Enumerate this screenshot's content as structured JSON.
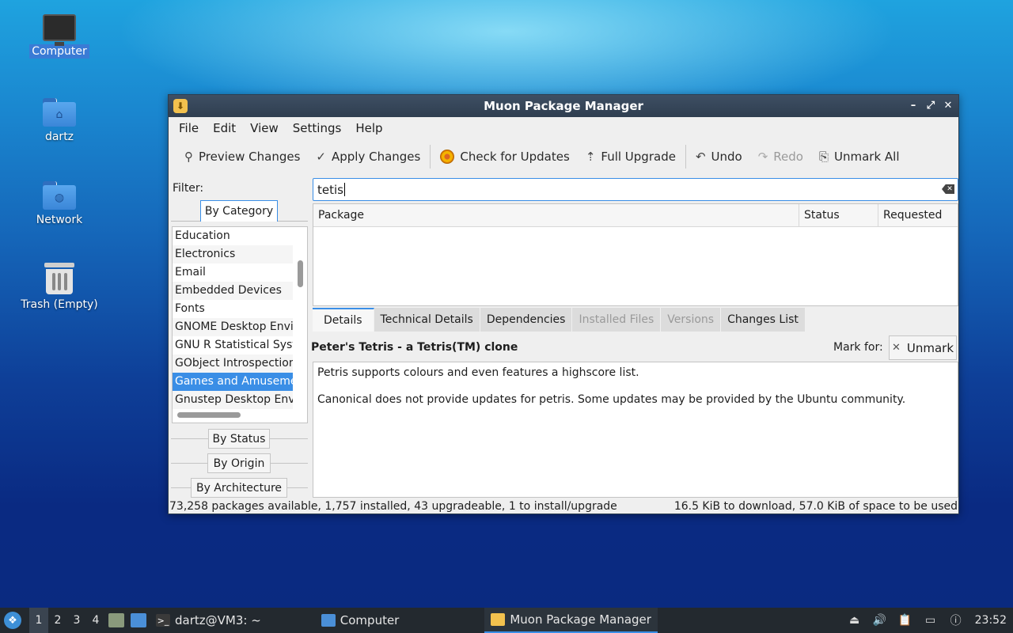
{
  "desktop": {
    "icons": [
      {
        "label": "Computer"
      },
      {
        "label": "dartz"
      },
      {
        "label": "Network"
      },
      {
        "label": "Trash (Empty)"
      }
    ]
  },
  "window": {
    "title": "Muon Package Manager",
    "menu": [
      "File",
      "Edit",
      "View",
      "Settings",
      "Help"
    ],
    "toolbar": {
      "preview": "Preview Changes",
      "apply": "Apply Changes",
      "check": "Check for Updates",
      "upgrade": "Full Upgrade",
      "undo": "Undo",
      "redo": "Redo",
      "unmark_all": "Unmark All"
    },
    "filter": {
      "label": "Filter:",
      "by_category": "By Category",
      "categories": [
        "Education",
        "Electronics",
        "Email",
        "Embedded Devices",
        "Fonts",
        "GNOME Desktop Envi",
        "GNU R Statistical Syst",
        "GObject Introspection",
        "Games and Amuseme",
        "Gnustep Desktop Envi"
      ],
      "selected_category": "Games and Amuseme",
      "by_status": "By Status",
      "by_origin": "By Origin",
      "by_architecture": "By Architecture"
    },
    "search": {
      "value": "tetis"
    },
    "table": {
      "columns": [
        "Package",
        "Status",
        "Requested"
      ]
    },
    "tabs": {
      "details": "Details",
      "technical": "Technical Details",
      "dependencies": "Dependencies",
      "installed_files": "Installed Files",
      "versions": "Versions",
      "changes": "Changes List"
    },
    "details": {
      "title": "Peter's Tetris - a Tetris(TM) clone",
      "mark_for": "Mark for:",
      "unmark": "Unmark",
      "desc1": "Petris supports colours and even features a highscore list.",
      "desc2": "Canonical does not provide updates for petris. Some updates may be provided by the Ubuntu community."
    },
    "status": {
      "left": "73,258 packages available, 1,757 installed, 43 upgradeable, 1 to install/upgrade",
      "right": "16.5 KiB to download, 57.0 KiB of space to be used"
    }
  },
  "taskbar": {
    "workspaces": [
      "1",
      "2",
      "3",
      "4"
    ],
    "tasks": {
      "terminal": "dartz@VM3: ~",
      "computer": "Computer",
      "muon": "Muon Package Manager"
    },
    "clock": "23:52"
  }
}
